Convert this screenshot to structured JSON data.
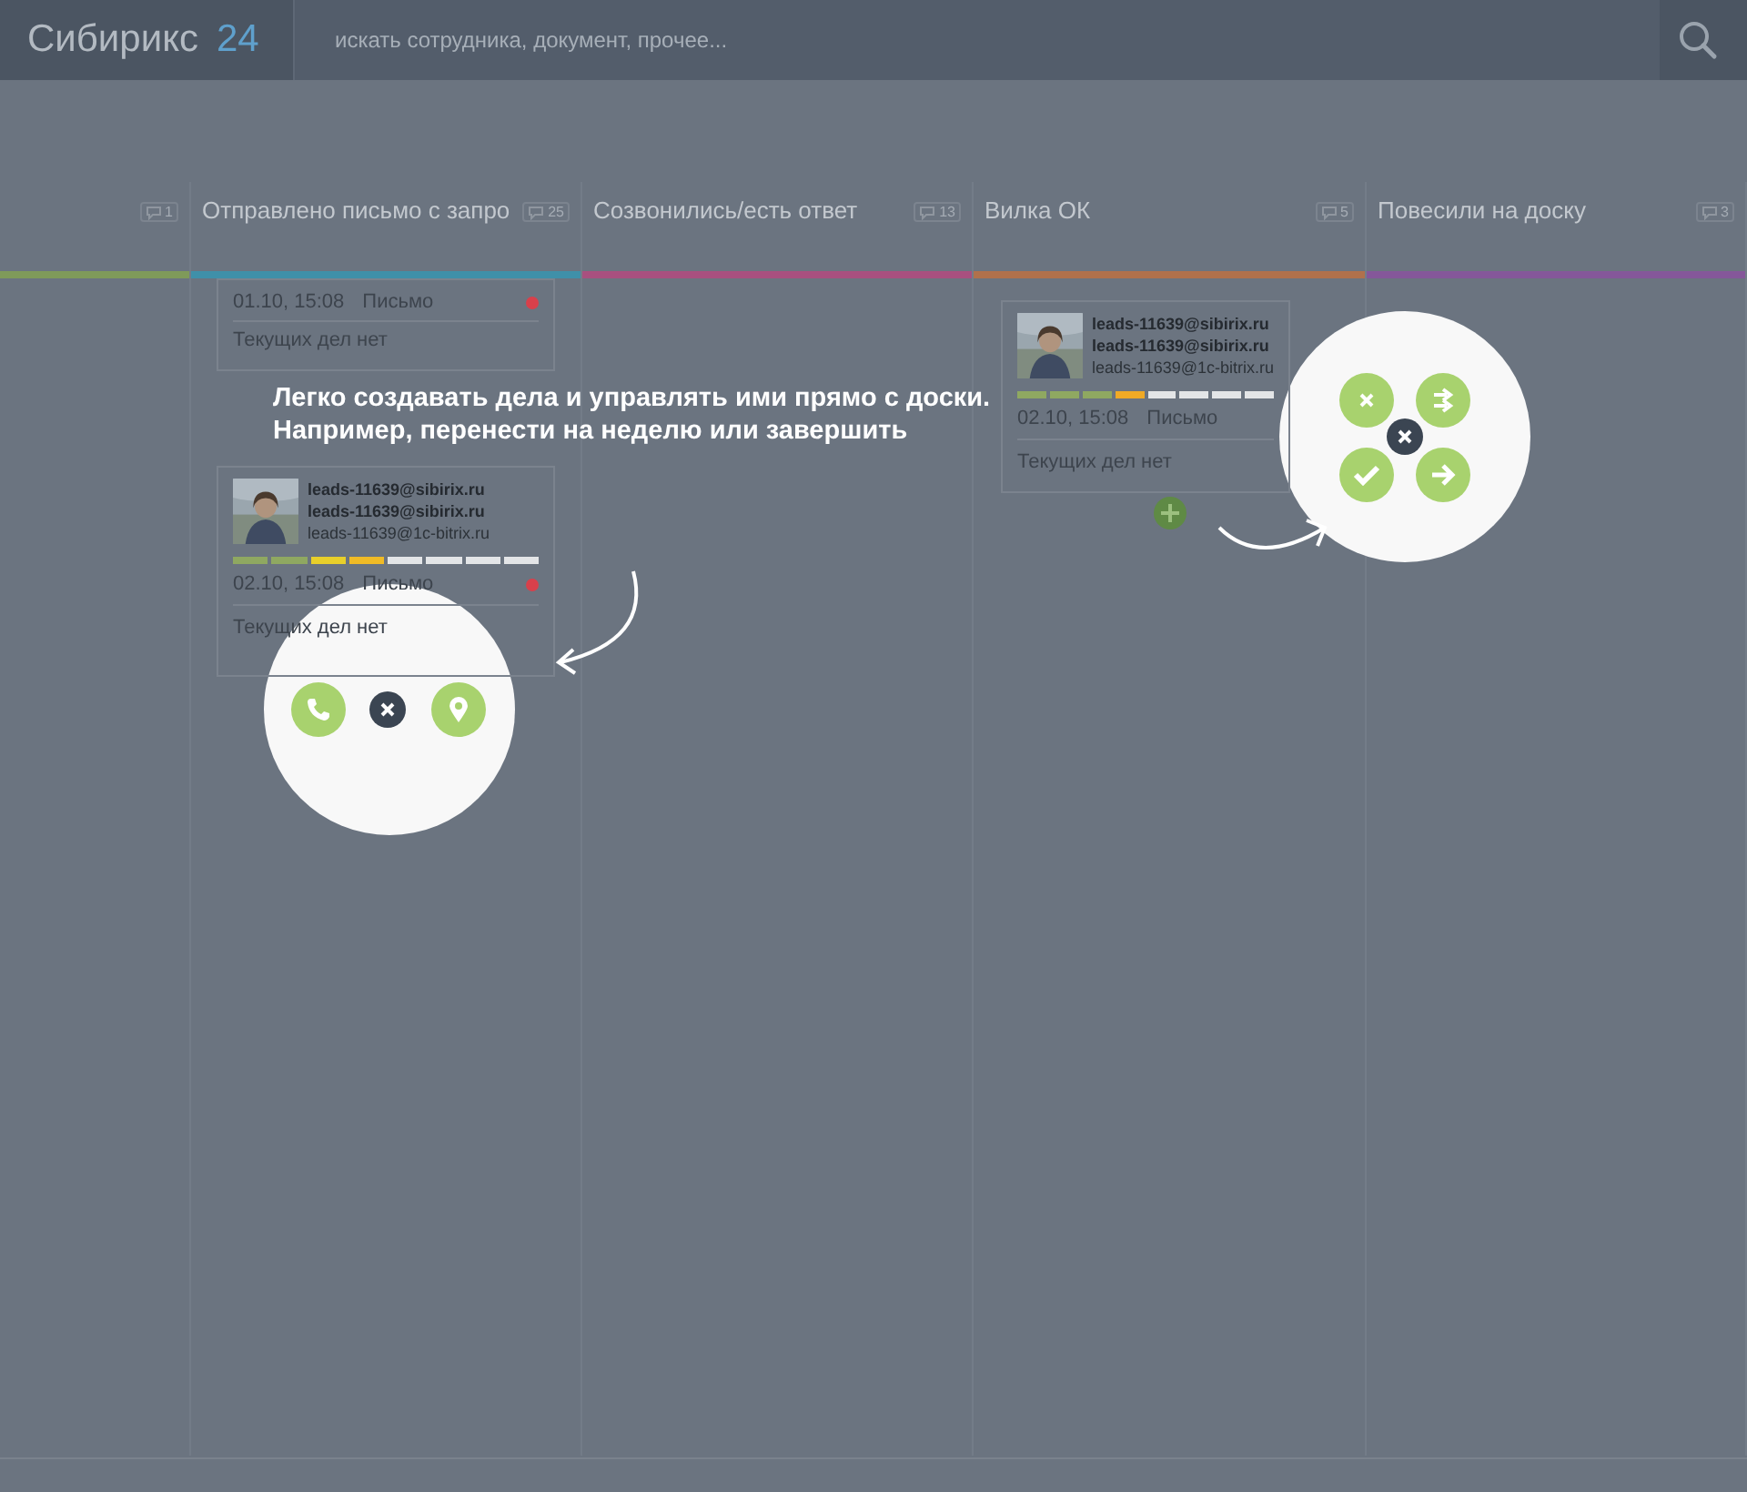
{
  "header": {
    "logo": "Сибирикс",
    "logo_number": "24",
    "search": {
      "placeholder": "искать сотрудника, документ, прочее..."
    }
  },
  "columns": [
    {
      "count": "1",
      "color": "#7f9a5a"
    },
    {
      "title": "Отправлено письмо с запро",
      "count": "25",
      "color": "#3f90a9",
      "cards": [
        {
          "kind": "compact",
          "date": "01.10, 15:08",
          "type": "Письмо",
          "alert": true,
          "activities": "Текущих дел нет"
        },
        {
          "kind": "full",
          "emails": [
            "leads-11639@sibirix.ru",
            "leads-11639@sibirix.ru",
            "leads-11639@1c-bitrix.ru"
          ],
          "segments": [
            {
              "color": "#8fa861"
            },
            {
              "color": "#8fa861"
            },
            {
              "color": "#e8cf2a"
            },
            {
              "color": "#f0bb26"
            },
            {
              "color": "#e3e5e7"
            },
            {
              "color": "#e3e5e7"
            },
            {
              "color": "#e3e5e7"
            },
            {
              "color": "#e3e5e7"
            }
          ],
          "date": "02.10, 15:08",
          "type": "Письмо",
          "alert": true,
          "activities": "Текущих дел нет"
        }
      ]
    },
    {
      "title": "Созвонились/есть ответ",
      "count": "13",
      "color": "#a8507f"
    },
    {
      "title": "Вилка ОК",
      "count": "5",
      "color": "#b0714c",
      "add_button": true,
      "cards": [
        {
          "kind": "full",
          "emails": [
            "leads-11639@sibirix.ru",
            "leads-11639@sibirix.ru",
            "leads-11639@1c-bitrix.ru"
          ],
          "segments": [
            {
              "color": "#8fa861"
            },
            {
              "color": "#8fa861"
            },
            {
              "color": "#8fa861"
            },
            {
              "color": "#f0aa26"
            },
            {
              "color": "#e3e5e7"
            },
            {
              "color": "#e3e5e7"
            },
            {
              "color": "#e3e5e7"
            },
            {
              "color": "#e3e5e7"
            }
          ],
          "date": "02.10, 15:08",
          "type": "Письмо",
          "alert": false,
          "activities": "Текущих дел нет"
        }
      ]
    },
    {
      "title": "Повесили на доску",
      "count": "3",
      "color": "#85579a"
    }
  ],
  "tour": {
    "hint": "Легко создавать дела и управлять ими прямо с доски.\nНапример, перенести на неделю или завершить",
    "spotlights": [
      {
        "actions": [
          {
            "kind": "call"
          },
          {
            "kind": "close"
          },
          {
            "kind": "location"
          }
        ]
      },
      {
        "actions": [
          {
            "kind": "cancel"
          },
          {
            "kind": "move"
          },
          {
            "kind": "close"
          },
          {
            "kind": "done"
          },
          {
            "kind": "next"
          }
        ]
      }
    ]
  }
}
